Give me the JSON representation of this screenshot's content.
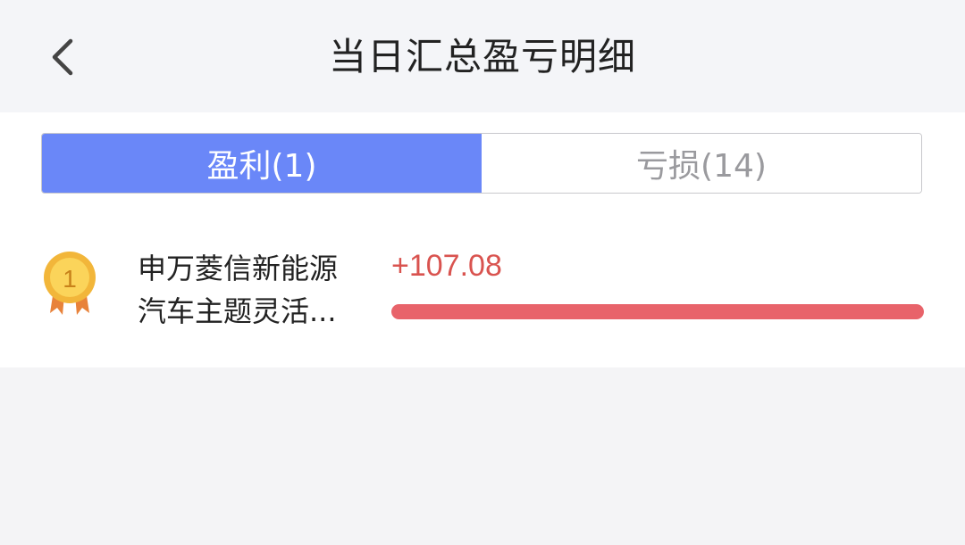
{
  "header": {
    "title": "当日汇总盈亏明细",
    "back_icon": "chevron-left-icon"
  },
  "tabs": [
    {
      "label": "盈利(1)",
      "active": true
    },
    {
      "label": "亏损(14)",
      "active": false
    }
  ],
  "list": [
    {
      "rank": "1",
      "name_line1": "申万菱信新能源",
      "name_line2": "汽车主题灵活...",
      "value": "+107.08",
      "bar_fraction": 1.0,
      "medal_icon": "gold-medal-icon"
    }
  ],
  "colors": {
    "accent": "#6a87f8",
    "profit": "#d9534f",
    "bar": "#e8636a"
  }
}
